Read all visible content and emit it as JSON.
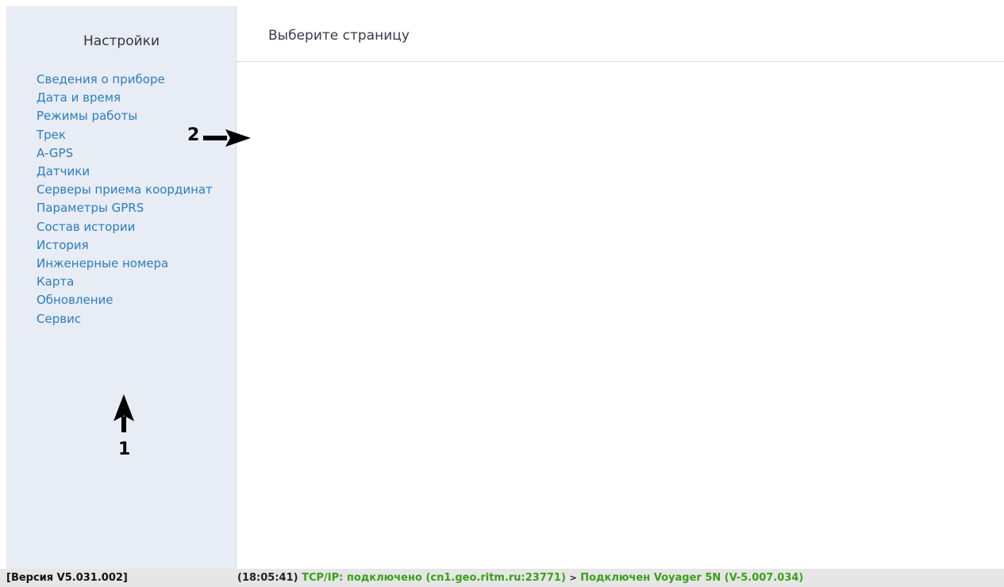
{
  "sidebar": {
    "title": "Настройки",
    "items": [
      {
        "label": "Сведения о приборе"
      },
      {
        "label": "Дата и время"
      },
      {
        "label": "Режимы работы"
      },
      {
        "label": "Трек"
      },
      {
        "label": "A-GPS"
      },
      {
        "label": "Датчики"
      },
      {
        "label": "Серверы приема координат"
      },
      {
        "label": "Параметры GPRS"
      },
      {
        "label": "Состав истории"
      },
      {
        "label": "История"
      },
      {
        "label": "Инженерные номера"
      },
      {
        "label": "Карта"
      },
      {
        "label": "Обновление"
      },
      {
        "label": "Сервис"
      }
    ]
  },
  "main": {
    "title": "Выберите страницу"
  },
  "status": {
    "version": "[Версия V5.031.002]",
    "time": "(18:05:41)",
    "connection": "TCP/IP: подключено (cn1.geo.ritm.ru:23771)",
    "separator": ">",
    "device": "Подключен Voyager 5N (V-5.007.034)"
  },
  "annotations": {
    "label_1": "1",
    "label_2": "2"
  },
  "colors": {
    "sidebar_bg": "#e8ecf4",
    "link": "#2a7ec0",
    "status_green": "#3aa019",
    "statusbar_bg": "#e6e6e6"
  }
}
